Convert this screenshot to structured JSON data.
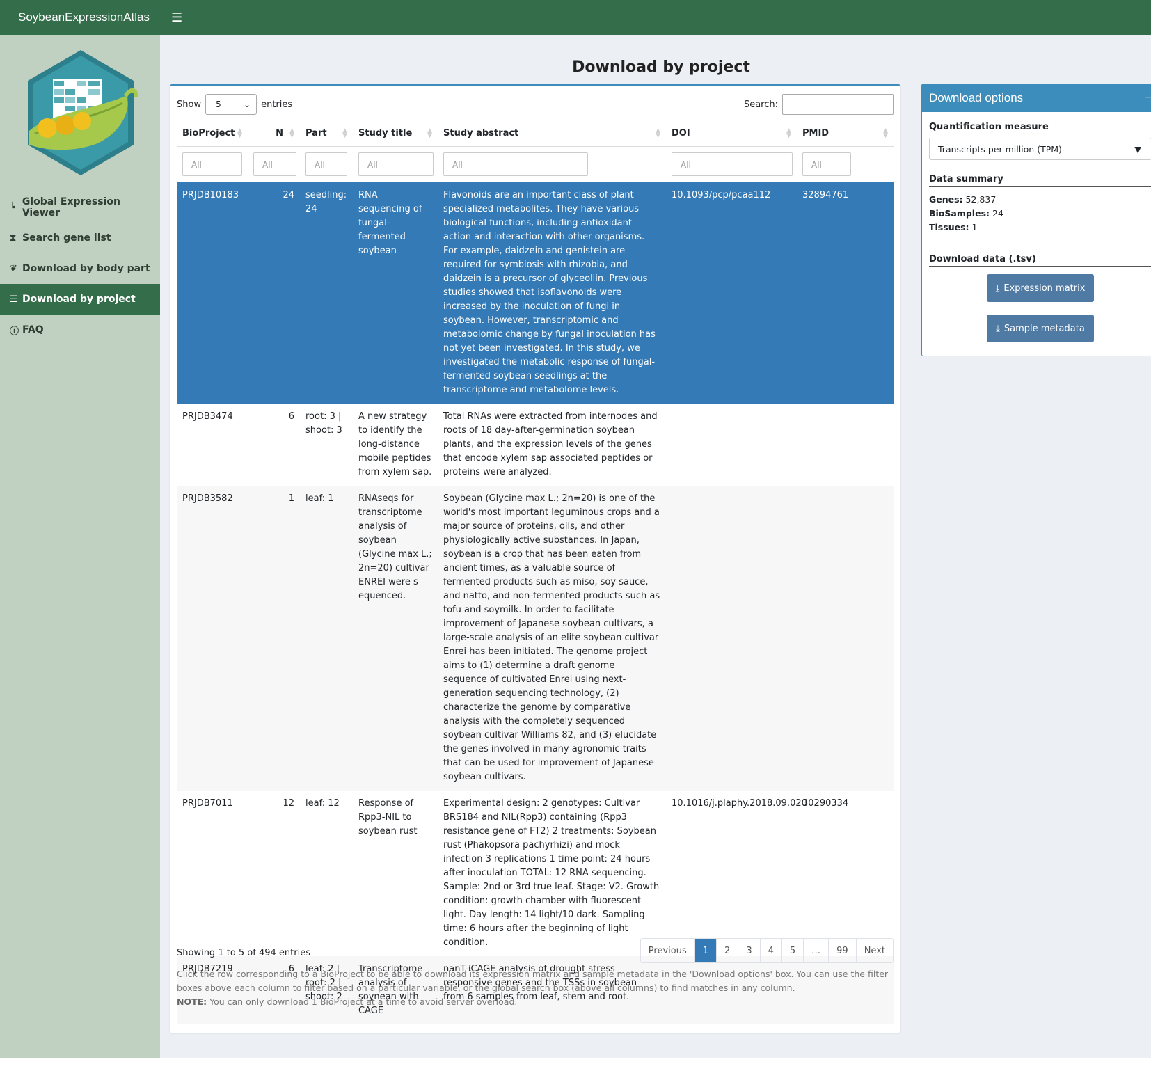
{
  "app": {
    "brand": "SoybeanExpressionAtlas"
  },
  "sidebar": {
    "items": [
      {
        "label": "Global Expression Viewer",
        "icon": "bar-chart-icon",
        "glyph": "╘"
      },
      {
        "label": "Search gene list",
        "icon": "hourglass-icon",
        "glyph": "⧗"
      },
      {
        "label": "Download by body part",
        "icon": "seedling-icon",
        "glyph": "❦"
      },
      {
        "label": "Download by project",
        "icon": "list-check-icon",
        "glyph": "☰"
      },
      {
        "label": "FAQ",
        "icon": "question-circle-icon",
        "glyph": "ⓘ"
      }
    ],
    "active_index": 3
  },
  "main": {
    "title": "Download by project",
    "length": {
      "show": "Show",
      "value": "5",
      "entries": "entries"
    },
    "search_label": "Search:",
    "columns": [
      "BioProject",
      "N",
      "Part",
      "Study title",
      "Study abstract",
      "DOI",
      "PMID"
    ],
    "filter_placeholders": [
      "All",
      "All",
      "All",
      "All",
      "All",
      "All",
      "All"
    ],
    "rows": [
      {
        "bioproject": "PRJDB10183",
        "n": "24",
        "part": "seedling: 24",
        "title": "RNA sequencing of fungal-fermented soybean",
        "abstract": "Flavonoids are an important class of plant specialized metabolites. They have various biological functions, including antioxidant action and interaction with other organisms. For example, daidzein and genistein are required for symbiosis with rhizobia, and daidzein is a precursor of glyceollin. Previous studies showed that isoflavonoids were increased by the inoculation of fungi in soybean. However, transcriptomic and metabolomic change by fungal inoculation has not yet been investigated. In this study, we investigated the metabolic response of fungal-fermented soybean seedlings at the transcriptome and metabolome levels.",
        "doi": "10.1093/pcp/pcaa112",
        "pmid": "32894761"
      },
      {
        "bioproject": "PRJDB3474",
        "n": "6",
        "part": "root: 3 | shoot: 3",
        "title": "A new strategy to identify the long-distance mobile peptides from xylem sap.",
        "abstract": "Total RNAs were extracted from internodes and roots of 18 day-after-germination soybean plants, and the expression levels of the genes that encode xylem sap associated peptides or proteins were analyzed.",
        "doi": "",
        "pmid": ""
      },
      {
        "bioproject": "PRJDB3582",
        "n": "1",
        "part": "leaf: 1",
        "title": "RNAseqs for transcriptome analysis of soybean (Glycine max L.; 2n=20) cultivar ENREI were s equenced.",
        "abstract": "Soybean (Glycine max L.; 2n=20) is one of the world's most important leguminous crops and a major source of proteins, oils, and other physiologically active substances. In Japan, soybean is a crop that has been eaten from ancient times, as a valuable source of fermented products such as miso, soy sauce, and natto, and non-fermented products such as tofu and soymilk. In order to facilitate improvement of Japanese soybean cultivars, a large-scale analysis of an elite soybean cultivar Enrei has been initiated. The genome project aims to (1) determine a draft genome sequence of cultivated Enrei using next-generation sequencing technology, (2) characterize the genome by comparative analysis with the completely sequenced soybean cultivar Williams 82, and (3) elucidate the genes involved in many agronomic traits that can be used for improvement of Japanese soybean cultivars.",
        "doi": "",
        "pmid": ""
      },
      {
        "bioproject": "PRJDB7011",
        "n": "12",
        "part": "leaf: 12",
        "title": "Response of Rpp3-NIL to soybean rust",
        "abstract": "Experimental design: 2 genotypes: Cultivar BRS184 and NIL(Rpp3) containing (Rpp3 resistance gene of FT2) 2 treatments: Soybean rust (Phakopsora pachyrhizi) and mock infection 3 replications 1 time point: 24 hours after inoculation TOTAL: 12 RNA sequencing. Sample: 2nd or 3rd true leaf. Stage: V2. Growth condition: growth chamber with fluorescent light. Day length: 14 light/10 dark. Sampling time: 6 hours after the beginning of light condition.",
        "doi": "10.1016/j.plaphy.2018.09.020",
        "pmid": "30290334"
      },
      {
        "bioproject": "PRJDB7219",
        "n": "6",
        "part": "leaf: 2 | root: 2 | shoot: 2",
        "title": "Transcriptome analysis of soynean with CAGE",
        "abstract": "nanT-iCAGE analysis of drought stress responsive genes and the TSSs in soybean from 6 samples from leaf, stem and root.",
        "doi": "",
        "pmid": ""
      }
    ],
    "info": "Showing 1 to 5 of 494 entries",
    "pagination": [
      "Previous",
      "1",
      "2",
      "3",
      "4",
      "5",
      "…",
      "99",
      "Next"
    ],
    "current_page": "1",
    "note_text": "Click the row corresponding to a BioProject to be able to download its expression matrix and sample metadata in the 'Download options' box. You can use the filter boxes above each column to filter based on a particular variable, or the global search box (above all columns) to find matches in any column.",
    "note_strong": "NOTE:",
    "note_rest": " You can only download 1 BioProject at a time to avoid server overload."
  },
  "download_options": {
    "title": "Download options",
    "collapse": "−",
    "measure_label": "Quantification measure",
    "measure_value": "Transcripts per million (TPM)",
    "summary_title": "Data summary",
    "genes_label": "Genes:",
    "genes_value": " 52,837",
    "biosamples_label": "BioSamples:",
    "biosamples_value": " 24",
    "tissues_label": "Tissues:",
    "tissues_value": " 1",
    "download_title": "Download data (.tsv)",
    "btn_matrix": "Expression matrix",
    "btn_metadata": "Sample metadata"
  },
  "colors": {
    "navbar": "#336d4a",
    "sidebar": "#c1d1c1",
    "accent": "#3c8dbc",
    "selected_row": "#337ab7"
  }
}
